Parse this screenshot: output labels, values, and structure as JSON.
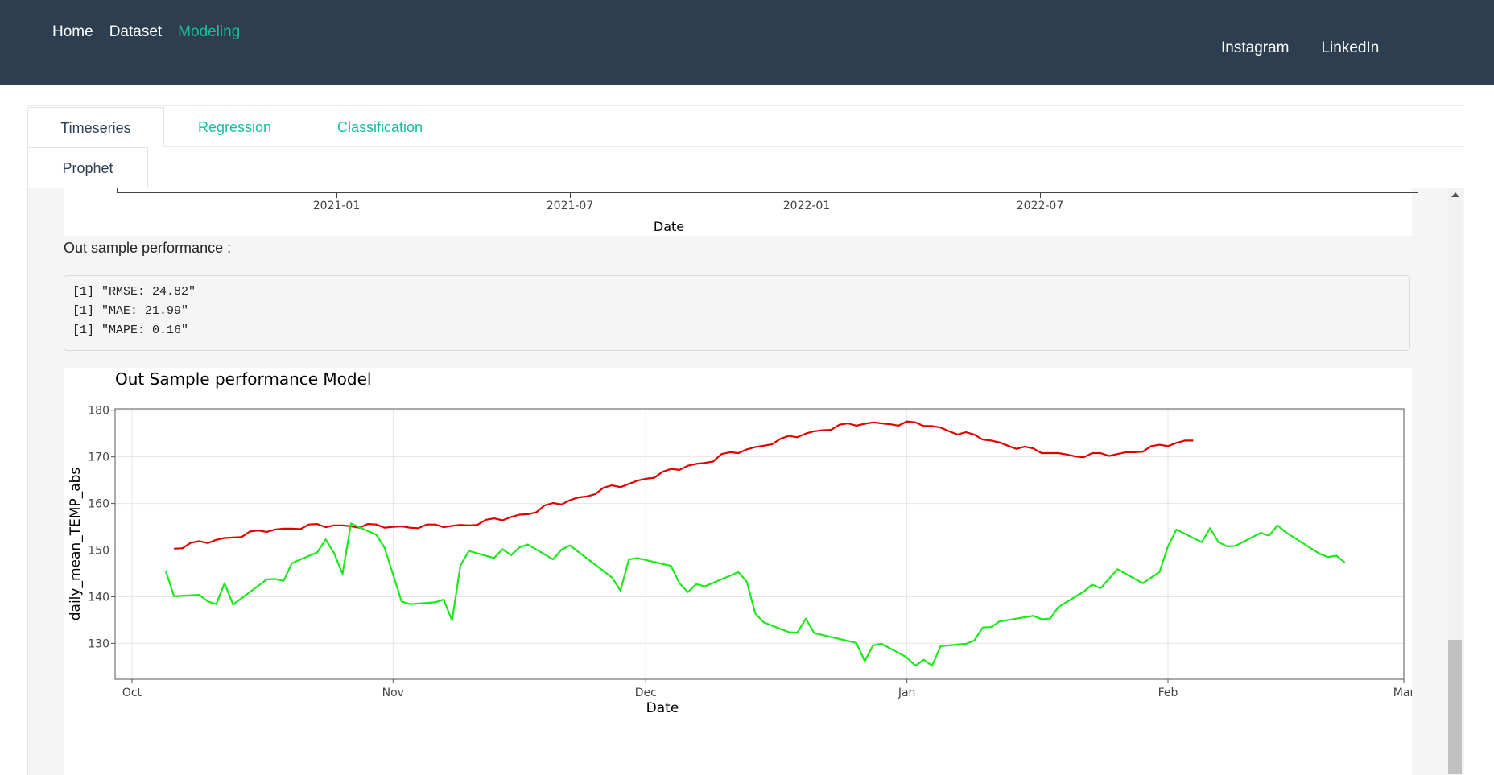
{
  "navbar": {
    "links_left": [
      "Home",
      "Dataset",
      "Modeling"
    ],
    "active": "Modeling",
    "links_right": [
      "Instagram",
      "LinkedIn"
    ],
    "accent_color": "#18bc9c",
    "background_color": "#2c3e50"
  },
  "tabs": {
    "row1": [
      "Timeseries",
      "Regression",
      "Classification"
    ],
    "row2": [
      "Prophet"
    ],
    "active": [
      "Timeseries",
      "Prophet"
    ]
  },
  "top_plot": {
    "x_tick_labels": [
      "2021-01",
      "2021-07",
      "2022-01",
      "2022-07"
    ],
    "xlabel": "Date"
  },
  "performance": {
    "heading": "Out sample performance :",
    "lines": [
      "[1] \"RMSE: 24.82\"",
      "[1] \"MAE: 21.99\"",
      "[1] \"MAPE: 0.16\""
    ]
  },
  "chart_data": {
    "type": "line",
    "title": "Out Sample performance Model",
    "xlabel": "Date",
    "ylabel": "daily_mean_TEMP_abs",
    "x_tick_labels": [
      "Oct",
      "Nov",
      "Dec",
      "Jan",
      "Feb",
      "Mar"
    ],
    "x_ticks": [
      "2022-10-01",
      "2022-11-01",
      "2022-12-01",
      "2023-01-01",
      "2023-02-01",
      "2023-03-01"
    ],
    "xlim": [
      "2022-09-29",
      "2023-03-01"
    ],
    "y_ticks": [
      130,
      140,
      150,
      160,
      170,
      180
    ],
    "ylim": [
      122.3,
      180.3
    ],
    "grid": true,
    "legend": false,
    "series": [
      {
        "color": "#e00000",
        "points": [
          [
            "2022-10-06",
            150.3
          ],
          [
            "2022-10-07",
            150.4
          ],
          [
            "2022-10-08",
            151.6
          ],
          [
            "2022-10-09",
            151.9
          ],
          [
            "2022-10-10",
            151.5
          ],
          [
            "2022-10-11",
            152.2
          ],
          [
            "2022-10-12",
            152.6
          ],
          [
            "2022-10-13",
            152.7
          ],
          [
            "2022-10-14",
            152.8
          ],
          [
            "2022-10-15",
            154.0
          ],
          [
            "2022-10-16",
            154.2
          ],
          [
            "2022-10-17",
            153.9
          ],
          [
            "2022-10-18",
            154.4
          ],
          [
            "2022-10-19",
            154.6
          ],
          [
            "2022-10-20",
            154.6
          ],
          [
            "2022-10-21",
            154.5
          ],
          [
            "2022-10-22",
            155.5
          ],
          [
            "2022-10-23",
            155.6
          ],
          [
            "2022-10-24",
            154.9
          ],
          [
            "2022-10-25",
            155.3
          ],
          [
            "2022-10-26",
            155.3
          ],
          [
            "2022-10-27",
            155.1
          ],
          [
            "2022-10-28",
            154.8
          ],
          [
            "2022-10-29",
            155.6
          ],
          [
            "2022-10-30",
            155.5
          ],
          [
            "2022-10-31",
            154.8
          ],
          [
            "2022-11-01",
            155.0
          ],
          [
            "2022-11-02",
            155.1
          ],
          [
            "2022-11-03",
            154.8
          ],
          [
            "2022-11-04",
            154.7
          ],
          [
            "2022-11-05",
            155.5
          ],
          [
            "2022-11-06",
            155.5
          ],
          [
            "2022-11-07",
            154.9
          ],
          [
            "2022-11-08",
            155.2
          ],
          [
            "2022-11-09",
            155.4
          ],
          [
            "2022-11-10",
            155.3
          ],
          [
            "2022-11-11",
            155.4
          ],
          [
            "2022-11-12",
            156.5
          ],
          [
            "2022-11-13",
            156.8
          ],
          [
            "2022-11-14",
            156.4
          ],
          [
            "2022-11-15",
            157.1
          ],
          [
            "2022-11-16",
            157.6
          ],
          [
            "2022-11-17",
            157.7
          ],
          [
            "2022-11-18",
            158.1
          ],
          [
            "2022-11-19",
            159.6
          ],
          [
            "2022-11-20",
            160.1
          ],
          [
            "2022-11-21",
            159.8
          ],
          [
            "2022-11-22",
            160.7
          ],
          [
            "2022-11-23",
            161.3
          ],
          [
            "2022-11-24",
            161.5
          ],
          [
            "2022-11-25",
            162.0
          ],
          [
            "2022-11-26",
            163.4
          ],
          [
            "2022-11-27",
            163.9
          ],
          [
            "2022-11-28",
            163.5
          ],
          [
            "2022-11-29",
            164.2
          ],
          [
            "2022-11-30",
            164.9
          ],
          [
            "2022-12-01",
            165.3
          ],
          [
            "2022-12-02",
            165.5
          ],
          [
            "2022-12-03",
            166.8
          ],
          [
            "2022-12-04",
            167.4
          ],
          [
            "2022-12-05",
            167.2
          ],
          [
            "2022-12-06",
            168.1
          ],
          [
            "2022-12-07",
            168.5
          ],
          [
            "2022-12-08",
            168.7
          ],
          [
            "2022-12-09",
            169.0
          ],
          [
            "2022-12-10",
            170.6
          ],
          [
            "2022-12-11",
            171.0
          ],
          [
            "2022-12-12",
            170.8
          ],
          [
            "2022-12-13",
            171.6
          ],
          [
            "2022-12-14",
            172.1
          ],
          [
            "2022-12-15",
            172.4
          ],
          [
            "2022-12-16",
            172.7
          ],
          [
            "2022-12-17",
            173.9
          ],
          [
            "2022-12-18",
            174.5
          ],
          [
            "2022-12-19",
            174.2
          ],
          [
            "2022-12-20",
            175.0
          ],
          [
            "2022-12-21",
            175.5
          ],
          [
            "2022-12-22",
            175.7
          ],
          [
            "2022-12-23",
            175.8
          ],
          [
            "2022-12-24",
            176.9
          ],
          [
            "2022-12-25",
            177.2
          ],
          [
            "2022-12-26",
            176.7
          ],
          [
            "2022-12-27",
            177.1
          ],
          [
            "2022-12-28",
            177.4
          ],
          [
            "2022-12-29",
            177.2
          ],
          [
            "2022-12-30",
            177.0
          ],
          [
            "2022-12-31",
            176.7
          ],
          [
            "2023-01-01",
            177.6
          ],
          [
            "2023-01-02",
            177.4
          ],
          [
            "2023-01-03",
            176.6
          ],
          [
            "2023-01-04",
            176.6
          ],
          [
            "2023-01-05",
            176.3
          ],
          [
            "2023-01-06",
            175.5
          ],
          [
            "2023-01-07",
            174.8
          ],
          [
            "2023-01-08",
            175.3
          ],
          [
            "2023-01-09",
            174.8
          ],
          [
            "2023-01-10",
            173.7
          ],
          [
            "2023-01-11",
            173.5
          ],
          [
            "2023-01-12",
            173.1
          ],
          [
            "2023-01-13",
            172.4
          ],
          [
            "2023-01-14",
            171.7
          ],
          [
            "2023-01-15",
            172.2
          ],
          [
            "2023-01-16",
            171.8
          ],
          [
            "2023-01-17",
            170.8
          ],
          [
            "2023-01-18",
            170.8
          ],
          [
            "2023-01-19",
            170.8
          ],
          [
            "2023-01-20",
            170.5
          ],
          [
            "2023-01-21",
            170.1
          ],
          [
            "2023-01-22",
            169.9
          ],
          [
            "2023-01-23",
            170.8
          ],
          [
            "2023-01-24",
            170.8
          ],
          [
            "2023-01-25",
            170.2
          ],
          [
            "2023-01-26",
            170.6
          ],
          [
            "2023-01-27",
            171.0
          ],
          [
            "2023-01-28",
            171.0
          ],
          [
            "2023-01-29",
            171.1
          ],
          [
            "2023-01-30",
            172.3
          ],
          [
            "2023-01-31",
            172.6
          ],
          [
            "2023-02-01",
            172.3
          ],
          [
            "2023-02-02",
            173.0
          ],
          [
            "2023-02-03",
            173.5
          ],
          [
            "2023-02-04",
            173.5
          ]
        ]
      },
      {
        "color": "#1de81d",
        "points": [
          [
            "2022-10-05",
            145.6
          ],
          [
            "2022-10-06",
            140.1
          ],
          [
            "2022-10-09",
            140.4
          ],
          [
            "2022-10-10",
            139.0
          ],
          [
            "2022-10-11",
            138.4
          ],
          [
            "2022-10-12",
            142.9
          ],
          [
            "2022-10-13",
            138.3
          ],
          [
            "2022-10-17",
            143.7
          ],
          [
            "2022-10-18",
            143.8
          ],
          [
            "2022-10-19",
            143.4
          ],
          [
            "2022-10-20",
            147.2
          ],
          [
            "2022-10-23",
            149.5
          ],
          [
            "2022-10-24",
            152.3
          ],
          [
            "2022-10-25",
            149.3
          ],
          [
            "2022-10-26",
            144.9
          ],
          [
            "2022-10-27",
            155.7
          ],
          [
            "2022-10-30",
            153.3
          ],
          [
            "2022-10-31",
            150.5
          ],
          [
            "2022-11-02",
            139.0
          ],
          [
            "2022-11-03",
            138.4
          ],
          [
            "2022-11-06",
            138.8
          ],
          [
            "2022-11-07",
            139.4
          ],
          [
            "2022-11-08",
            134.9
          ],
          [
            "2022-11-09",
            146.7
          ],
          [
            "2022-11-10",
            149.8
          ],
          [
            "2022-11-13",
            148.3
          ],
          [
            "2022-11-14",
            150.2
          ],
          [
            "2022-11-15",
            148.9
          ],
          [
            "2022-11-16",
            150.6
          ],
          [
            "2022-11-17",
            151.2
          ],
          [
            "2022-11-20",
            148.0
          ],
          [
            "2022-11-21",
            150.1
          ],
          [
            "2022-11-22",
            151.0
          ],
          [
            "2022-11-27",
            144.1
          ],
          [
            "2022-11-28",
            141.3
          ],
          [
            "2022-11-29",
            148.0
          ],
          [
            "2022-11-30",
            148.3
          ],
          [
            "2022-12-04",
            146.6
          ],
          [
            "2022-12-05",
            142.9
          ],
          [
            "2022-12-06",
            141.0
          ],
          [
            "2022-12-07",
            142.7
          ],
          [
            "2022-12-08",
            142.2
          ],
          [
            "2022-12-11",
            144.5
          ],
          [
            "2022-12-12",
            145.3
          ],
          [
            "2022-12-13",
            143.2
          ],
          [
            "2022-12-14",
            136.4
          ],
          [
            "2022-12-15",
            134.5
          ],
          [
            "2022-12-18",
            132.4
          ],
          [
            "2022-12-19",
            132.3
          ],
          [
            "2022-12-20",
            135.3
          ],
          [
            "2022-12-21",
            132.2
          ],
          [
            "2022-12-26",
            130.1
          ],
          [
            "2022-12-27",
            126.2
          ],
          [
            "2022-12-28",
            129.6
          ],
          [
            "2022-12-29",
            129.9
          ],
          [
            "2023-01-01",
            127.0
          ],
          [
            "2023-01-02",
            125.2
          ],
          [
            "2023-01-03",
            126.5
          ],
          [
            "2023-01-04",
            125.2
          ],
          [
            "2023-01-05",
            129.4
          ],
          [
            "2023-01-08",
            129.9
          ],
          [
            "2023-01-09",
            130.6
          ],
          [
            "2023-01-10",
            133.4
          ],
          [
            "2023-01-11",
            133.5
          ],
          [
            "2023-01-12",
            134.7
          ],
          [
            "2023-01-16",
            135.9
          ],
          [
            "2023-01-17",
            135.2
          ],
          [
            "2023-01-18",
            135.3
          ],
          [
            "2023-01-19",
            137.8
          ],
          [
            "2023-01-22",
            141.1
          ],
          [
            "2023-01-23",
            142.6
          ],
          [
            "2023-01-24",
            141.8
          ],
          [
            "2023-01-26",
            145.9
          ],
          [
            "2023-01-29",
            142.9
          ],
          [
            "2023-01-31",
            145.3
          ],
          [
            "2023-02-01",
            150.8
          ],
          [
            "2023-02-02",
            154.4
          ],
          [
            "2023-02-05",
            151.7
          ],
          [
            "2023-02-06",
            154.7
          ],
          [
            "2023-02-07",
            151.7
          ],
          [
            "2023-02-08",
            150.8
          ],
          [
            "2023-02-09",
            150.9
          ],
          [
            "2023-02-12",
            153.7
          ],
          [
            "2023-02-13",
            153.1
          ],
          [
            "2023-02-14",
            155.3
          ],
          [
            "2023-02-15",
            153.8
          ],
          [
            "2023-02-19",
            149.2
          ],
          [
            "2023-02-20",
            148.5
          ],
          [
            "2023-02-21",
            148.8
          ],
          [
            "2023-02-22",
            147.3
          ]
        ]
      }
    ]
  }
}
